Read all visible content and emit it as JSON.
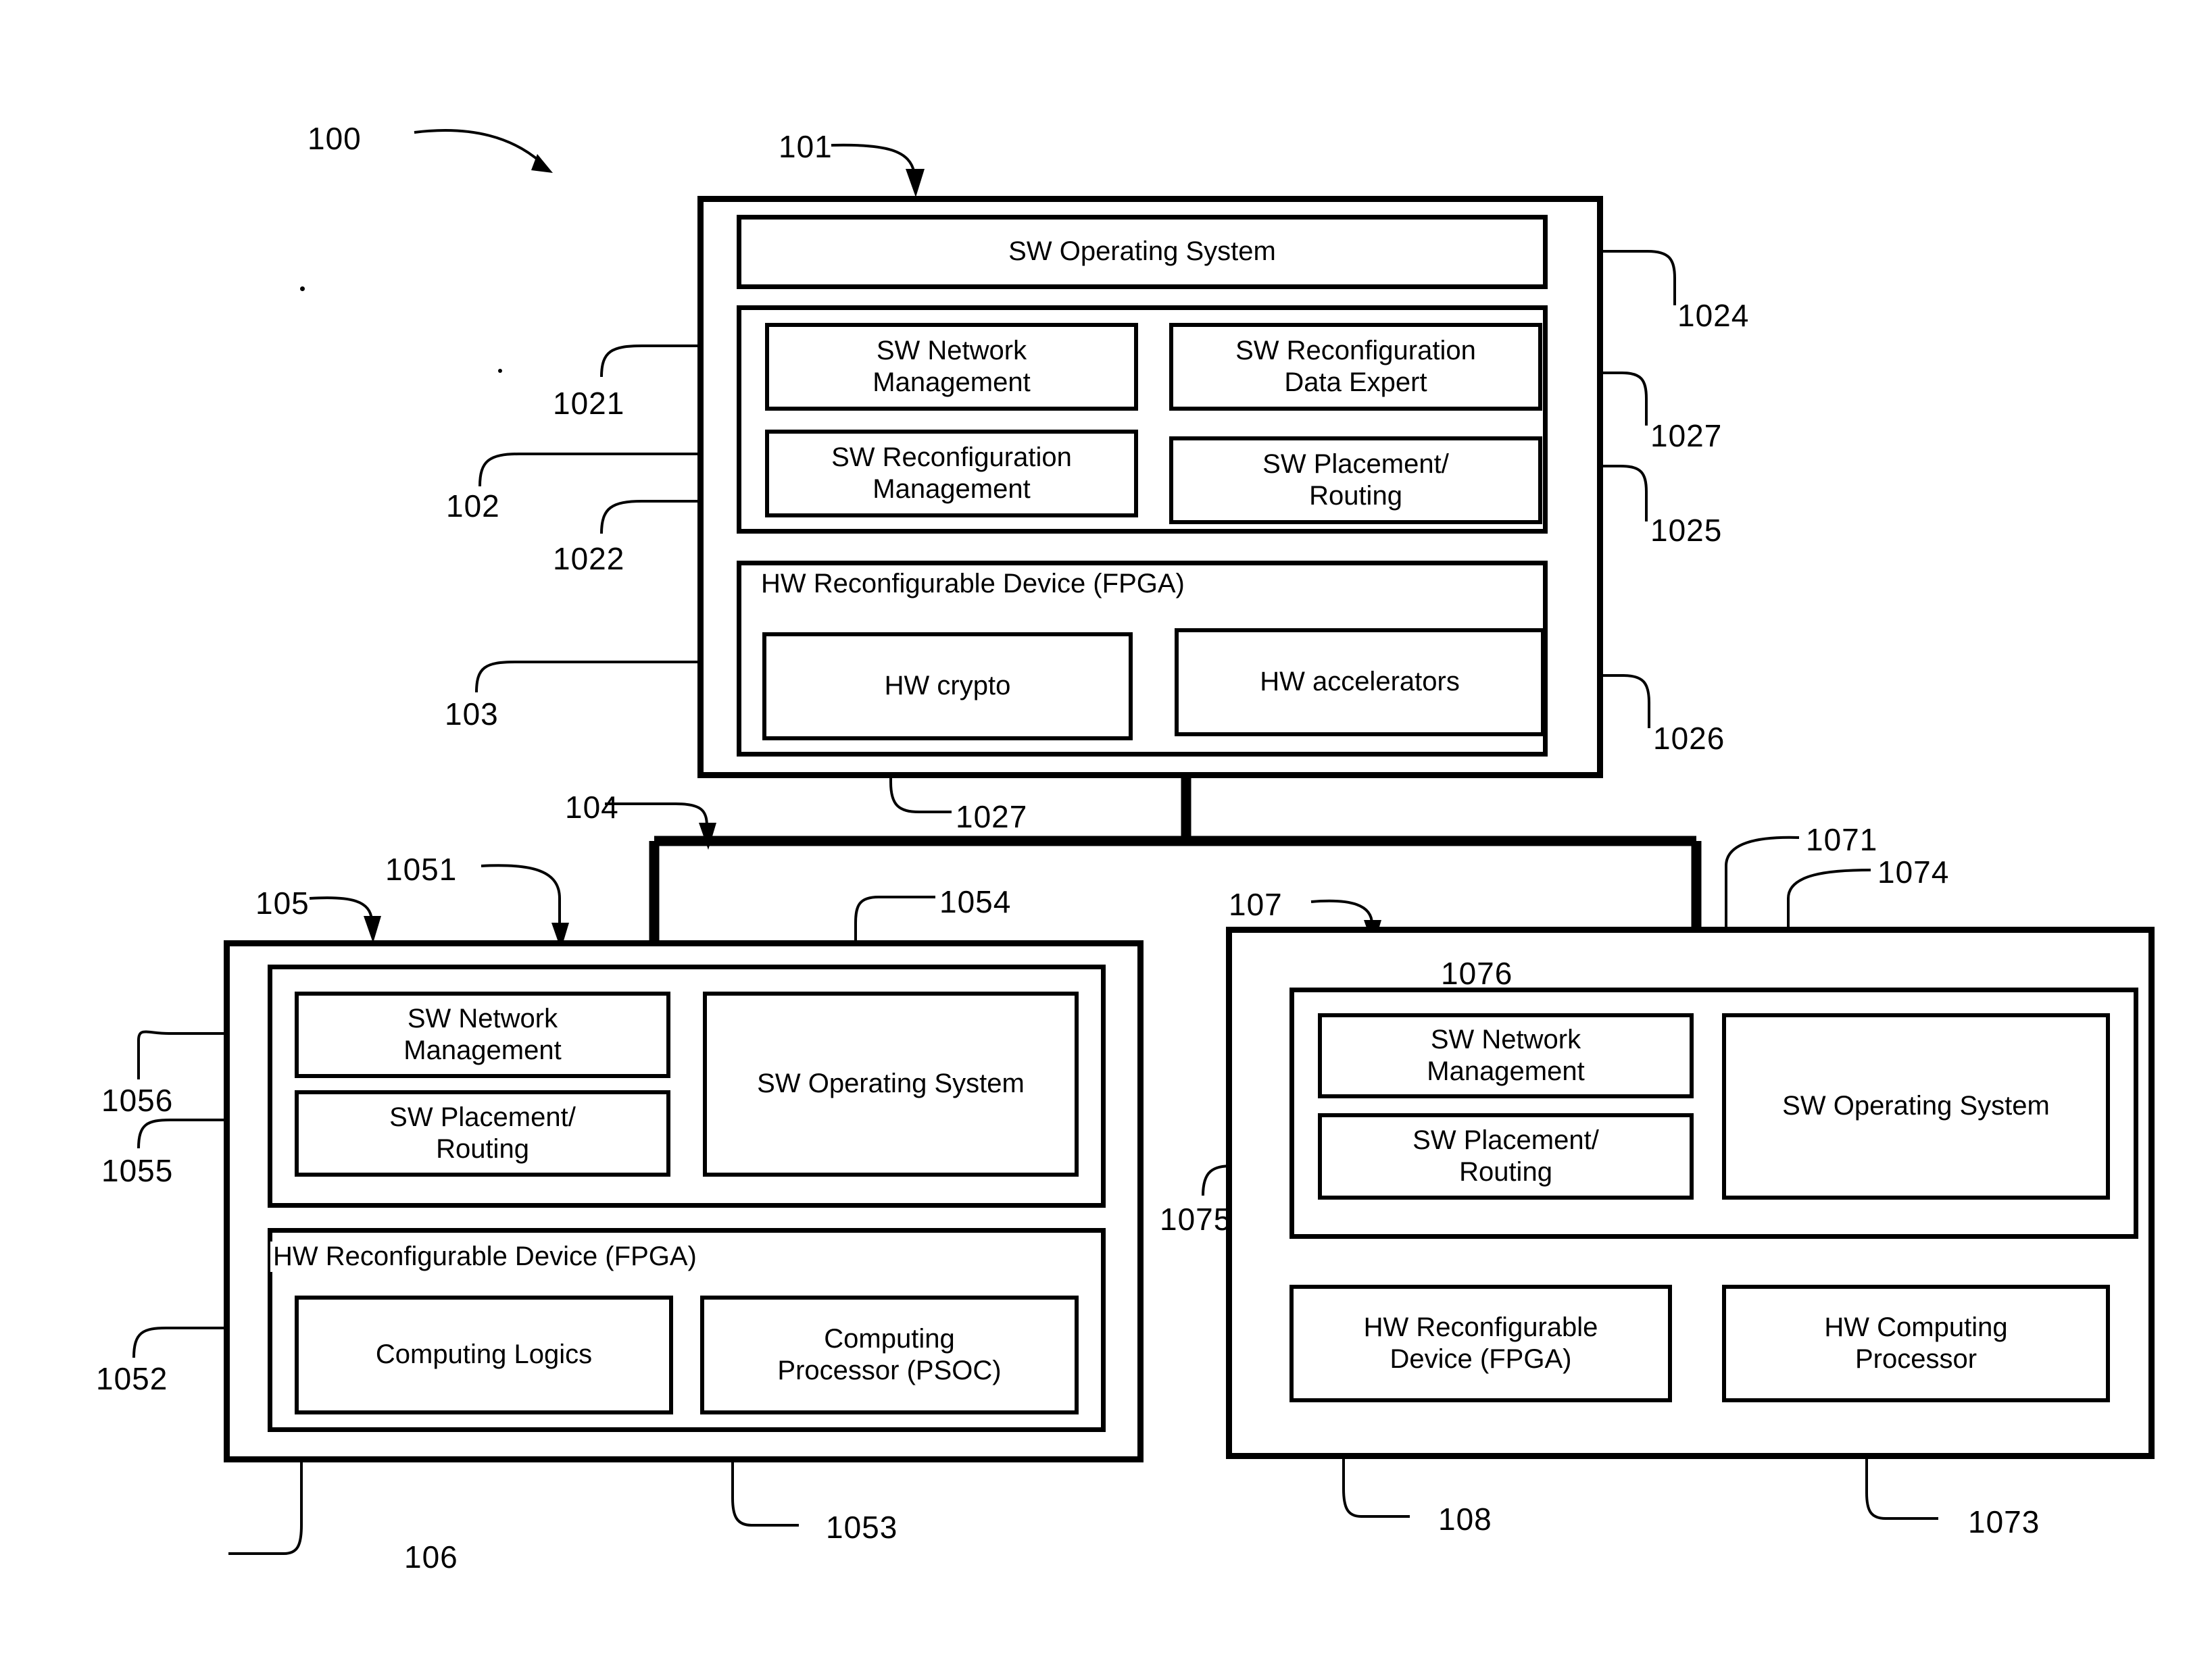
{
  "figure": {
    "id": "100",
    "type": "patent-block-diagram"
  },
  "nodes": {
    "master": {
      "ref": "101",
      "os": {
        "label": "SW Operating System",
        "ref": "1024"
      },
      "sw_group": {
        "ref": "102",
        "items": [
          {
            "label": "SW Network\nManagement",
            "ref": "1021"
          },
          {
            "label": "SW Reconfiguration\nData Expert",
            "ref": "1027"
          },
          {
            "label": "SW Reconfiguration\nManagement",
            "ref": "1022"
          },
          {
            "label": "SW Placement/\nRouting",
            "ref": "1025"
          }
        ]
      },
      "hw_group": {
        "title": "HW Reconfigurable Device (FPGA)",
        "ref": "103",
        "items": [
          {
            "label": "HW crypto",
            "ref": "1027"
          },
          {
            "label": "HW accelerators",
            "ref": "1026"
          }
        ]
      }
    },
    "bus": {
      "ref": "104"
    },
    "node_left": {
      "ref": "105",
      "sw_group": {
        "ref": "1051",
        "items": [
          {
            "label": "SW Network\nManagement",
            "ref": "1056"
          },
          {
            "label": "SW Placement/\nRouting",
            "ref": "1055"
          },
          {
            "label": "SW Operating System",
            "ref": "1054"
          }
        ]
      },
      "hw_group": {
        "title": "HW Reconfigurable Device (FPGA)",
        "ref": "106",
        "items": [
          {
            "label": "Computing Logics",
            "ref": "1052"
          },
          {
            "label": "Computing\nProcessor (PSOC)",
            "ref": "1053"
          }
        ]
      }
    },
    "node_right": {
      "ref": "107",
      "sw_group": {
        "ref": "1071",
        "items": [
          {
            "label": "SW Network\nManagement",
            "ref": "1076"
          },
          {
            "label": "SW Placement/\nRouting",
            "ref": "1075"
          },
          {
            "label": "SW Operating System",
            "ref": "1074"
          }
        ]
      },
      "hw_items": [
        {
          "label": "HW Reconfigurable\nDevice (FPGA)",
          "ref": "108"
        },
        {
          "label": "HW Computing\nProcessor",
          "ref": "1073"
        }
      ]
    }
  },
  "refs": {
    "r100": "100",
    "r101": "101",
    "r102": "102",
    "r103": "103",
    "r104": "104",
    "r105": "105",
    "r106": "106",
    "r107": "107",
    "r108": "108",
    "r1021": "1021",
    "r1022": "1022",
    "r1024": "1024",
    "r1025": "1025",
    "r1026": "1026",
    "r1027a": "1027",
    "r1027b": "1027",
    "r1051": "1051",
    "r1052": "1052",
    "r1053": "1053",
    "r1054": "1054",
    "r1055": "1055",
    "r1056": "1056",
    "r1071": "1071",
    "r1073": "1073",
    "r1074": "1074",
    "r1075": "1075",
    "r1076": "1076"
  },
  "labels": {
    "sw_operating_system": "SW Operating System",
    "sw_network_management": "SW Network\nManagement",
    "sw_reconfiguration_data_expert": "SW Reconfiguration\nData Expert",
    "sw_reconfiguration_management": "SW Reconfiguration\nManagement",
    "sw_placement_routing": "SW Placement/\nRouting",
    "hw_reconfigurable_device_fpga": "HW Reconfigurable Device (FPGA)",
    "hw_reconfigurable_device_fpga_2line": "HW Reconfigurable\nDevice (FPGA)",
    "hw_crypto": "HW crypto",
    "hw_accelerators": "HW accelerators",
    "computing_logics": "Computing Logics",
    "computing_processor_psoc": "Computing\nProcessor (PSOC)",
    "hw_computing_processor": "HW Computing\nProcessor"
  },
  "colors": {
    "ink": "#000000",
    "paper": "#ffffff"
  }
}
